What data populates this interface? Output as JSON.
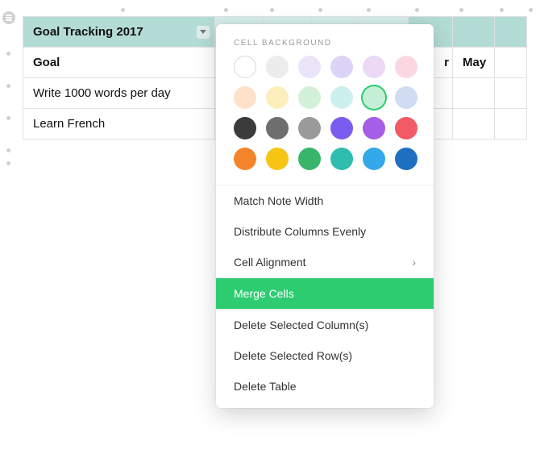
{
  "table": {
    "title": "Goal Tracking 2017",
    "headers": [
      "Goal",
      "May"
    ],
    "header_partial": "r",
    "rows": [
      {
        "goal": "Write 1000 words per day"
      },
      {
        "goal": "Learn French"
      }
    ]
  },
  "popover": {
    "section_label": "CELL BACKGROUND",
    "swatches": [
      {
        "color": "#ffffff",
        "outline": true
      },
      {
        "color": "#ececec"
      },
      {
        "color": "#e9e4f8"
      },
      {
        "color": "#dcd4f7"
      },
      {
        "color": "#ecd9f5"
      },
      {
        "color": "#fbd8e1"
      },
      {
        "color": "#fde1c9"
      },
      {
        "color": "#fceebd"
      },
      {
        "color": "#d3f0d8"
      },
      {
        "color": "#ccf0ee"
      },
      {
        "color": "#c4efd6",
        "selected": true
      },
      {
        "color": "#cfdcf2"
      },
      {
        "color": "#3b3b3b"
      },
      {
        "color": "#6e6e6e"
      },
      {
        "color": "#9a9a9a"
      },
      {
        "color": "#7b5cf0"
      },
      {
        "color": "#a55ee8"
      },
      {
        "color": "#f25a66"
      },
      {
        "color": "#f4842a"
      },
      {
        "color": "#f6c514"
      },
      {
        "color": "#37b56b"
      },
      {
        "color": "#2fbdb0"
      },
      {
        "color": "#34a9ea"
      },
      {
        "color": "#1f6fc1"
      }
    ],
    "items_top": [
      {
        "label": "Match Note Width"
      },
      {
        "label": "Distribute Columns Evenly"
      },
      {
        "label": "Cell Alignment",
        "submenu": true
      }
    ],
    "highlight": {
      "label": "Merge Cells"
    },
    "items_bottom": [
      {
        "label": "Delete Selected Column(s)"
      },
      {
        "label": "Delete Selected Row(s)"
      },
      {
        "label": "Delete Table"
      }
    ]
  }
}
